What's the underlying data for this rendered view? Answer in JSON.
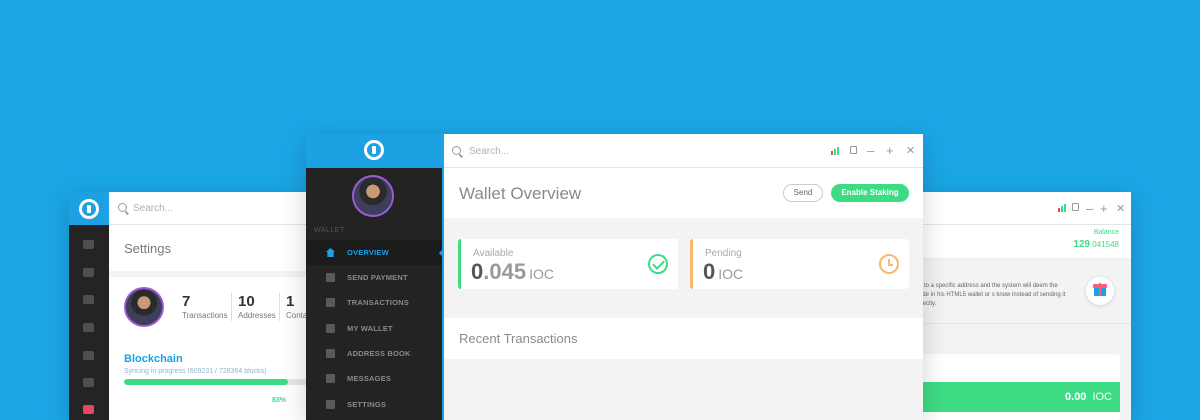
{
  "colors": {
    "background": "#1ba6e6",
    "accent": "#1da1e2",
    "success": "#3ddc84",
    "pending": "#f5b971"
  },
  "left_window": {
    "search_placeholder": "Search...",
    "title": "Settings",
    "stats": [
      {
        "value": "7",
        "label": "Transactions"
      },
      {
        "value": "10",
        "label": "Addresses"
      },
      {
        "value": "1",
        "label": "Conta"
      }
    ],
    "blockchain": {
      "title": "Blockchain",
      "status": "Syncing in progress (609231 / 728364 blocks)",
      "progress": 0.83,
      "progress_label": "83%"
    },
    "sidebar_icons": [
      "home-icon",
      "send-icon",
      "transfer-icon",
      "wallet-icon",
      "star-icon",
      "chat-icon",
      "settings-icon"
    ]
  },
  "center_window": {
    "search_placeholder": "Search...",
    "sidebar": {
      "section_label": "WALLET",
      "items": [
        {
          "label": "OVERVIEW",
          "icon": "home-icon",
          "active": true
        },
        {
          "label": "SEND PAYMENT",
          "icon": "send-icon"
        },
        {
          "label": "TRANSACTIONS",
          "icon": "transfer-icon"
        },
        {
          "label": "MY WALLET",
          "icon": "wallet-icon"
        },
        {
          "label": "ADDRESS BOOK",
          "icon": "star-icon"
        },
        {
          "label": "MESSAGES",
          "icon": "chat-icon"
        },
        {
          "label": "SETTINGS",
          "icon": "gear-icon"
        }
      ]
    },
    "title": "Wallet Overview",
    "buttons": {
      "send": "Send",
      "staking": "Enable Staking"
    },
    "available": {
      "label": "Available",
      "integer": "0",
      "decimal": ".045",
      "unit": "IOC"
    },
    "pending": {
      "label": "Pending",
      "integer": "0",
      "decimal": "",
      "unit": "IOC"
    },
    "recent_title": "Recent Transactions"
  },
  "right_window": {
    "balance_label": "Balance",
    "balance_int": "129",
    "balance_dec": ".041548",
    "description": "ns to a specific address and the system will deem the code in his HTML5 wallet or s know instead of sending it directly.",
    "amount": "0.00",
    "amount_unit": "IOC"
  }
}
